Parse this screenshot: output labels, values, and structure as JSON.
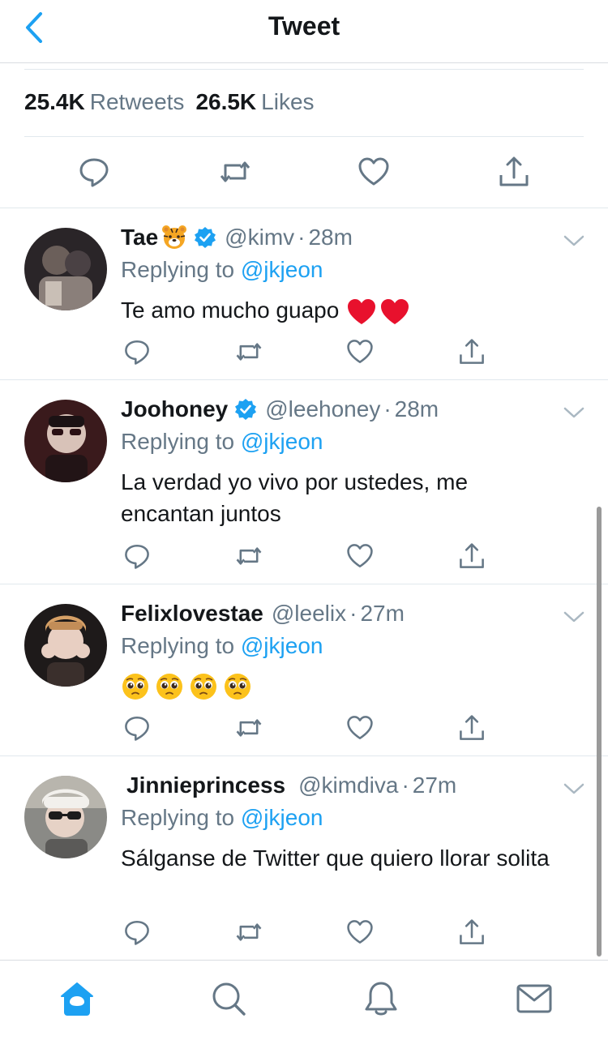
{
  "header": {
    "title": "Tweet",
    "back_icon": "chevron-left-icon"
  },
  "stats": {
    "retweets_count": "25.4K",
    "retweets_label": "Retweets",
    "likes_count": "26.5K",
    "likes_label": "Likes"
  },
  "colors": {
    "accent": "#1da1f2",
    "secondary_text": "#657786",
    "heart": "#e0245e",
    "divider": "#e1e8ed"
  },
  "replies": [
    {
      "name": "Tae",
      "name_emoji": "tiger-face-emoji",
      "verified": true,
      "handle": "@kimv",
      "dot": "·",
      "time": "28m",
      "replying_prefix": "Replying to",
      "replying_to": "@jkjeon",
      "text": "Te amo mucho guapo",
      "text_emojis": [
        "red-heart-emoji",
        "red-heart-emoji"
      ]
    },
    {
      "name": "Joohoney",
      "verified": true,
      "handle": "@leehoney",
      "dot": "·",
      "time": "28m",
      "replying_prefix": "Replying to",
      "replying_to": "@jkjeon",
      "text": "La verdad yo vivo por ustedes, me encantan juntos"
    },
    {
      "name": "Felixlovestae",
      "verified": false,
      "handle": "@leelix",
      "dot": "·",
      "time": "27m",
      "replying_prefix": "Replying to",
      "replying_to": "@jkjeon",
      "text": "",
      "text_emojis": [
        "pleading-face-emoji",
        "pleading-face-emoji",
        "pleading-face-emoji",
        "pleading-face-emoji"
      ]
    },
    {
      "name": "Jinnieprincess",
      "verified": false,
      "handle": "@kimdiva",
      "dot": "·",
      "time": "27m",
      "replying_prefix": "Replying to",
      "replying_to": "@jkjeon",
      "text": "Sálganse de Twitter que quiero llorar solita"
    }
  ],
  "tabbar": {
    "items": [
      "home-icon",
      "search-icon",
      "notifications-bell-icon",
      "messages-envelope-icon"
    ],
    "active": "home-icon"
  }
}
